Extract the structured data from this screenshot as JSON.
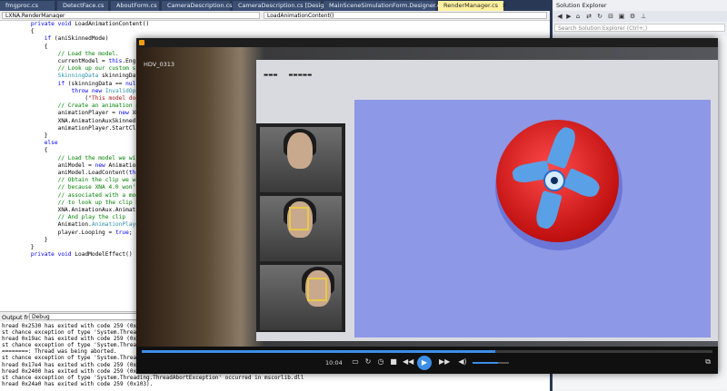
{
  "tabs": [
    {
      "label": "fmgproc.cs",
      "active": false
    },
    {
      "label": "DetectFace.cs",
      "active": false
    },
    {
      "label": "AboutForm.cs",
      "active": false
    },
    {
      "label": "CameraDescription.cs",
      "active": false
    },
    {
      "label": "CameraDescription.cs [Design]",
      "active": false
    },
    {
      "label": "MainSceneSimulationForm.Designer.cs",
      "active": false
    },
    {
      "label": "RenderManager.cs",
      "active": true
    }
  ],
  "tab_close": "×",
  "nav": {
    "class_box": "LXNA.RenderManager",
    "member_box": "LoadAnimationContent()"
  },
  "code_lines": [
    "        private void LoadAnimationContent()",
    "        {",
    "            if (aniSkinnedMode)",
    "            {",
    "                // Load the model.",
    "                currentModel = this.EngineCont",
    "                // Look up our custom skinnin",
    "                SkinningData skinningData = c",
    "",
    "                if (skinningData == null)",
    "                    throw new InvalidOperati",
    "                        (\"This model does not",
    "",
    "                // Create an animation player",
    "                animationPlayer = new XNA.Ani",
    "",
    "                XNA.AnimationAuxSkinned.Anima",
    "",
    "                animationPlayer.StartClip(cli",
    "            }",
    "            else",
    "            {",
    "                // Load the model we will dis",
    "                aniModel = new Animation.Anim",
    "                aniModel.LoadContent(this.Engi",
    "                // Obtain the clip we want to",
    "                // because XNA 4.0 won't allo",
    "                // associated with a model, s",
    "                // to look up the clip by nam",
    "                XNA.AnimationAux.AnimationCli",
    "                // And play the clip",
    "                Animation.AnimationPlayer pla",
    "                player.Looping = true;",
    "            }",
    "        }",
    "",
    "        private void LoadModelEffect()"
  ],
  "output": {
    "from_label": "Output from:",
    "source": "Debug",
    "lines": [
      "hread 0x2530 has exited with code 259 (0x103",
      "st chance exception of type 'System.Threadin",
      "hread 0x19ac has exited with code 259 (0x103",
      "st chance exception of type 'System.Threadin",
      "========: Thread was being aborted.",
      "st chance exception of type 'System.Threadin",
      "hread 0x17e4 has exited with code 259 (0x103",
      "hread 0x2400 has exited with code 259 (0x103",
      "st chance exception of type 'System.Threading.ThreadAbortException' occurred in mscorlib.dll",
      "hread 0x24a0 has exited with code 259 (0x103)."
    ]
  },
  "solution_explorer": {
    "title": "Solution Explorer",
    "search_placeholder": "Search Solution Explorer (Ctrl+;)"
  },
  "player": {
    "title": "HDV_0313",
    "time": "10:04",
    "progress": 0.62,
    "volume": 0.7
  },
  "colors": {
    "vs_chrome": "#293955",
    "active_tab": "#fff2a0",
    "accent": "#3d8ee6",
    "sphere": "#d11a1a",
    "backdrop": "#8d98e6"
  }
}
